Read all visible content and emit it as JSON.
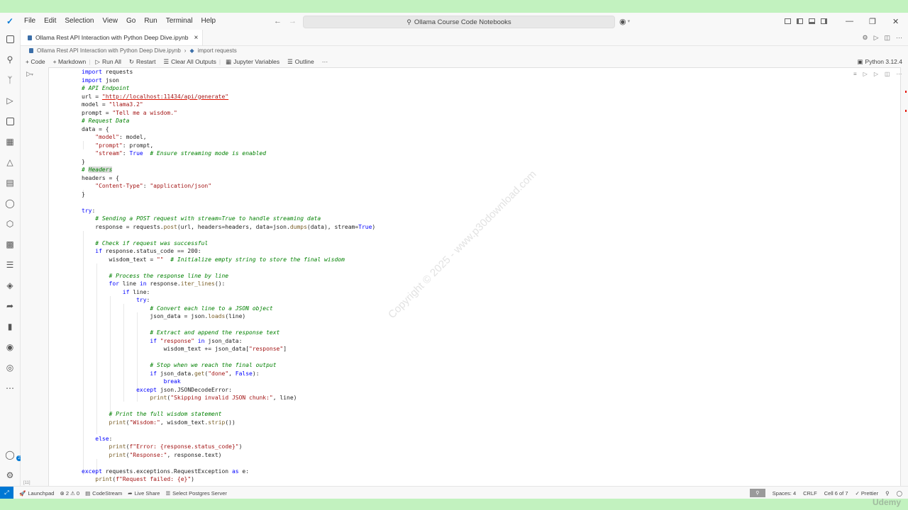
{
  "menu": [
    "File",
    "Edit",
    "Selection",
    "View",
    "Go",
    "Run",
    "Terminal",
    "Help"
  ],
  "search": {
    "label": "Ollama Course Code Notebooks"
  },
  "tab": {
    "label": "Ollama Rest API Interaction with Python Deep Dive.ipynb",
    "close": "×"
  },
  "breadcrumb": {
    "file": "Ollama Rest API Interaction with Python Deep Dive.ipynb",
    "sep": "›",
    "cell": "import requests"
  },
  "toolbar": {
    "code": "+ Code",
    "markdown": "+ Markdown",
    "run_all": "Run All",
    "restart": "Restart",
    "clear_all": "Clear All Outputs",
    "variables": "Jupyter Variables",
    "outline": "Outline",
    "more": "···",
    "kernel": "Python 3.12.4"
  },
  "cell": {
    "exec_count": "[11]"
  },
  "code_lines": [
    "import requests",
    "import json",
    "# API Endpoint",
    "url = \"http://localhost:11434/api/generate\"",
    "model = \"llama3.2\"",
    "prompt = \"Tell me a wisdom.\"",
    "# Request Data",
    "data = {",
    "    \"model\": model,",
    "    \"prompt\": prompt,",
    "    \"stream\": True  # Ensure streaming mode is enabled",
    "}",
    "# Headers",
    "headers = {",
    "    \"Content-Type\": \"application/json\"",
    "}",
    "",
    "try:",
    "    # Sending a POST request with stream=True to handle streaming data",
    "    response = requests.post(url, headers=headers, data=json.dumps(data), stream=True)",
    "",
    "    # Check if request was successful",
    "    if response.status_code == 200:",
    "        wisdom_text = \"\"  # Initialize empty string to store the final wisdom",
    "",
    "        # Process the response line by line",
    "        for line in response.iter_lines():",
    "            if line:",
    "                try:",
    "                    # Convert each line to a JSON object",
    "                    json_data = json.loads(line)",
    "",
    "                    # Extract and append the response text",
    "                    if \"response\" in json_data:",
    "                        wisdom_text += json_data[\"response\"]",
    "",
    "                    # Stop when we reach the final output",
    "                    if json_data.get(\"done\", False):",
    "                        break",
    "                except json.JSONDecodeError:",
    "                    print(\"Skipping invalid JSON chunk:\", line)",
    "",
    "        # Print the full wisdom statement",
    "        print(\"Wisdom:\", wisdom_text.strip())",
    "",
    "    else:",
    "        print(f\"Error: {response.status_code}\")",
    "        print(\"Response:\", response.text)",
    "",
    "except requests.exceptions.RequestException as e:",
    "    print(f\"Request failed: {e}\")"
  ],
  "watermark": "Copyright © 2025 - www.p30download.com",
  "status": {
    "launchpad": "Launchpad",
    "problems": "⊗ 2  ⚠ 0",
    "codestream": "CodeStream",
    "liveshare": "Live Share",
    "postgres": "Select Postgres Server",
    "spaces": "Spaces: 4",
    "eol": "CRLF",
    "cell": "Cell 6 of 7",
    "prettier": "Prettier"
  },
  "brand": "Udemy",
  "colors": {
    "accent": "#0078d4",
    "background": "#c2f2bf"
  }
}
